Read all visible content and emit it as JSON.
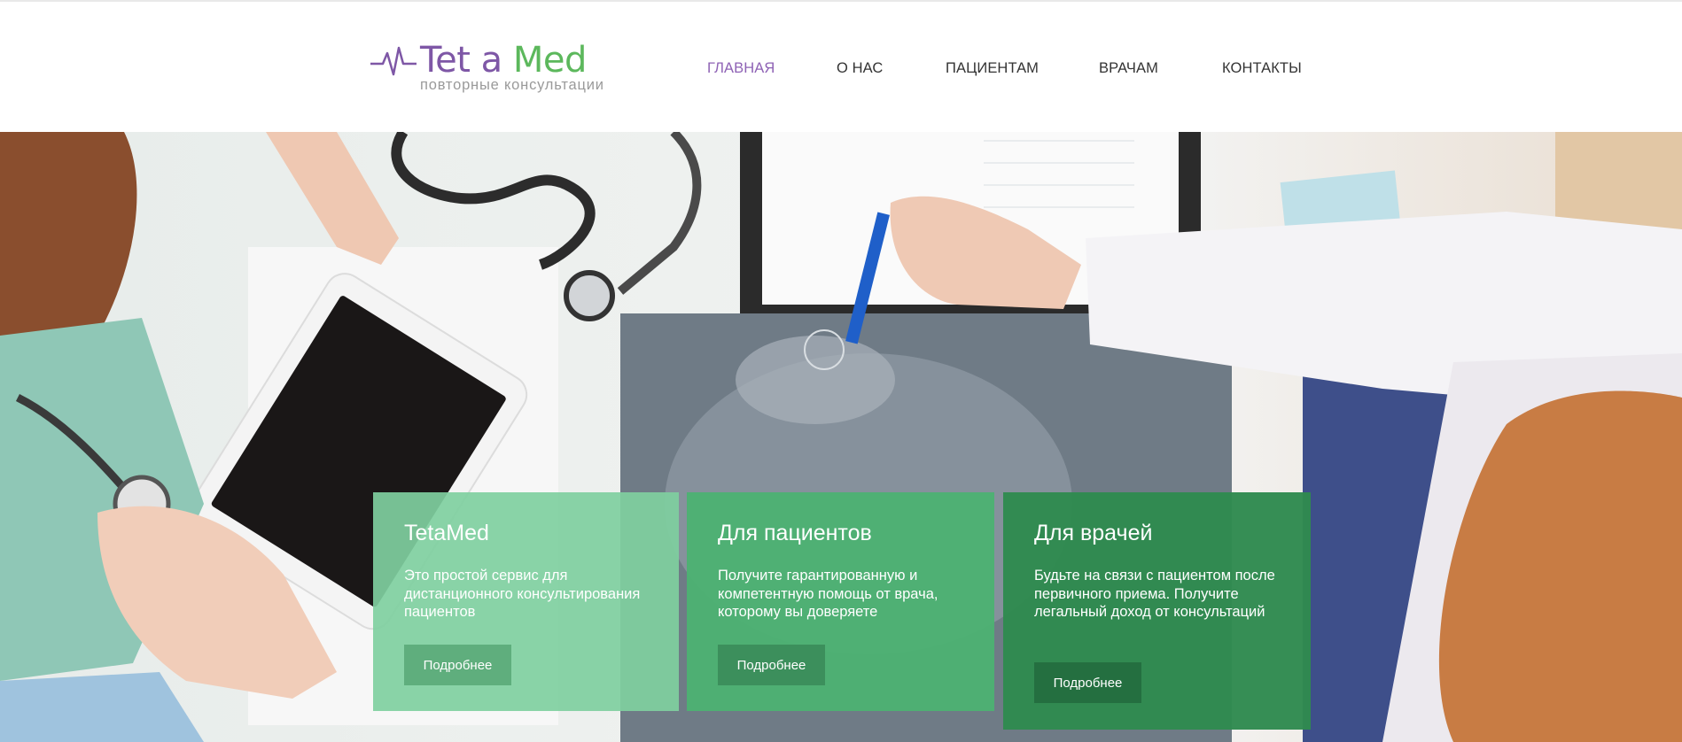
{
  "logo": {
    "title_part1": "Tet a ",
    "title_part2": "Med",
    "subtitle": "повторные консультации"
  },
  "nav": {
    "items": [
      {
        "label": "ГЛАВНАЯ",
        "active": true
      },
      {
        "label": "О НАС",
        "active": false
      },
      {
        "label": "ПАЦИЕНТАМ",
        "active": false
      },
      {
        "label": "ВРАЧАМ",
        "active": false
      },
      {
        "label": "КОНТАКТЫ",
        "active": false
      }
    ]
  },
  "cards": [
    {
      "title": "TetaMed",
      "text": "Это простой сервис для дистанционного консультирования пациентов",
      "button": "Подробнее",
      "color": "#7fcfa0"
    },
    {
      "title": "Для пациентов",
      "text": "Получите гарантированную и компетентную помощь от врача, которому вы доверяете",
      "button": "Подробнее",
      "color": "#4cb272"
    },
    {
      "title": "Для врачей",
      "text": "Будьте на связи с пациентом после первичного приема. Получите легальный доход от консультаций",
      "button": "Подробнее",
      "color": "#2f8a50"
    }
  ],
  "colors": {
    "brand_purple": "#7e57a6",
    "brand_green": "#5cb85c",
    "nav_active": "#8e62b5"
  }
}
